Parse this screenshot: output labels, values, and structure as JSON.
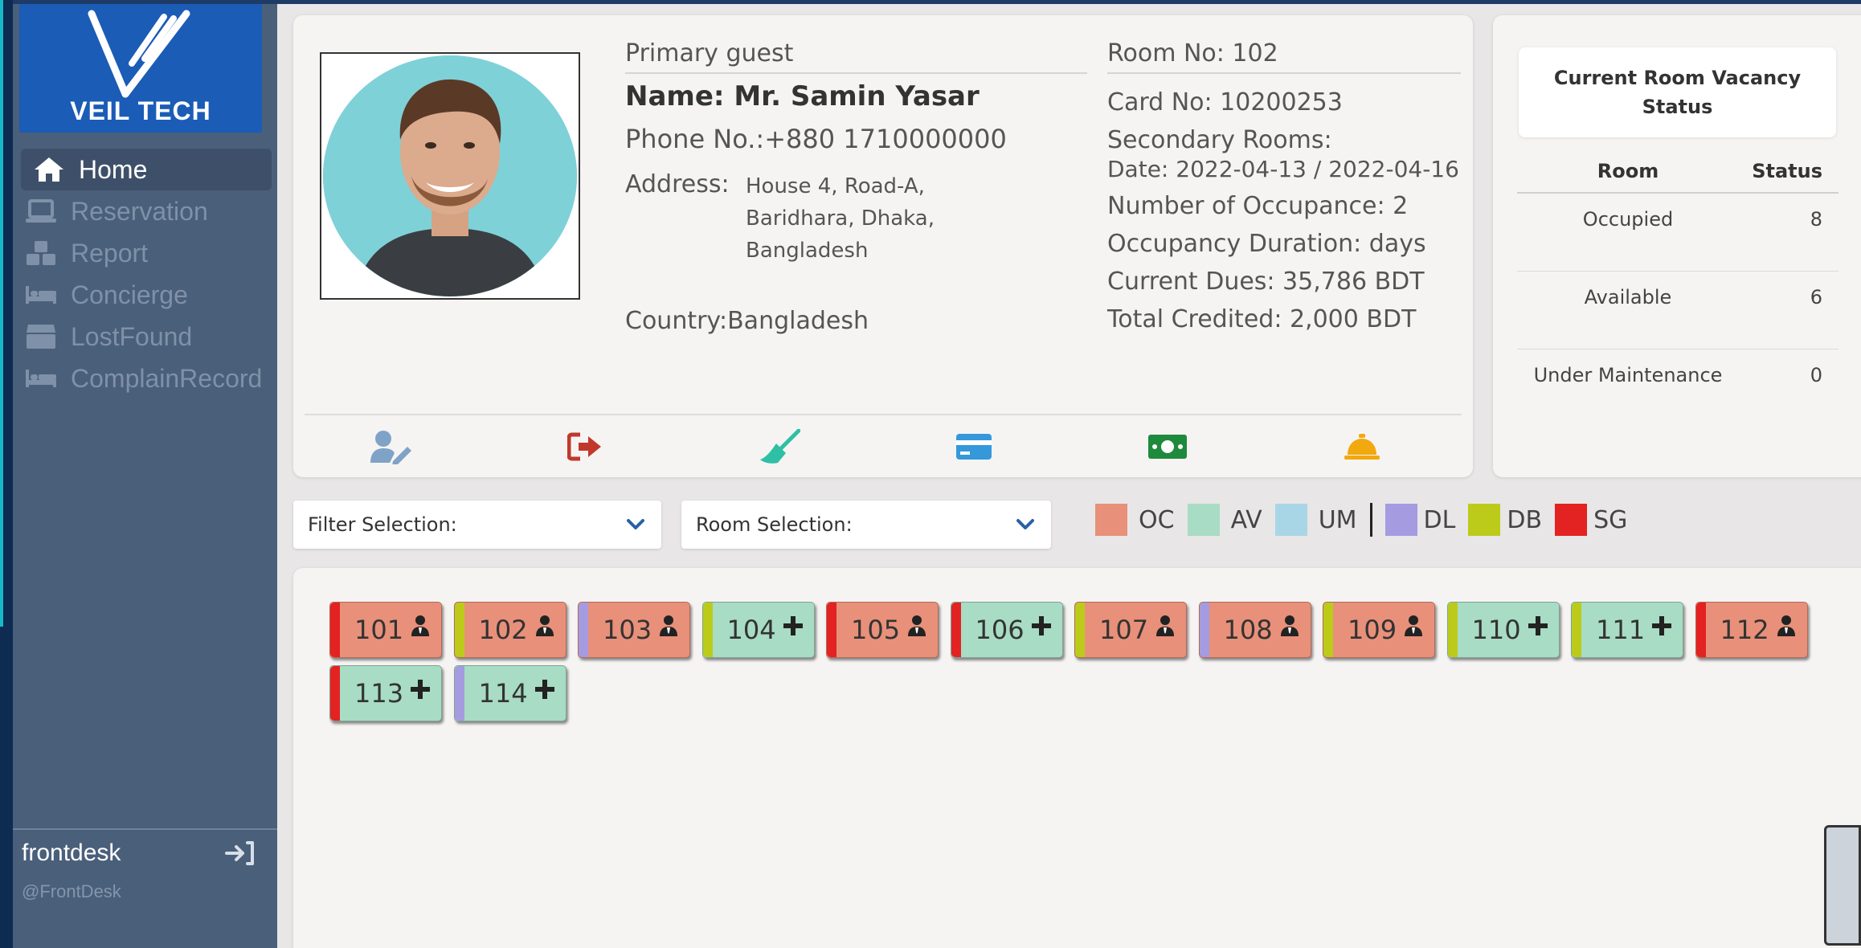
{
  "brand": {
    "name": "VEIL TECH",
    "logo_color": "#1b5cb6"
  },
  "sidebar": {
    "items": [
      {
        "label": "Home",
        "icon": "home-icon",
        "active": true
      },
      {
        "label": "Reservation",
        "icon": "laptop-icon",
        "active": false
      },
      {
        "label": "Report",
        "icon": "cubes-icon",
        "active": false
      },
      {
        "label": "Concierge",
        "icon": "bed-icon",
        "active": false
      },
      {
        "label": "LostFound",
        "icon": "box-icon",
        "active": false
      },
      {
        "label": "ComplainRecord",
        "icon": "bed-icon",
        "active": false
      }
    ],
    "user": {
      "name": "frontdesk",
      "handle": "@FrontDesk"
    }
  },
  "guest": {
    "label": "Primary guest",
    "name": "Name: Mr. Samin Yasar",
    "phone": "Phone No.:+880 1710000000",
    "address_label": "Address:",
    "address_lines": [
      "House 4, Road-A,",
      "Baridhara, Dhaka,",
      "Bangladesh"
    ],
    "country": "Country:Bangladesh"
  },
  "room_info": {
    "room_no": "Room No: 102",
    "card_no": "Card No: 10200253",
    "secondary": "Secondary Rooms:",
    "date": "Date: 2022-04-13 / 2022-04-16",
    "occupants": "Number of Occupance: 2",
    "duration": "Occupancy Duration: days",
    "dues": "Current Dues: 35,786 BDT",
    "credited": "Total Credited: 2,000 BDT"
  },
  "actions": [
    {
      "icon": "user-edit-icon",
      "color": "#7fa3c7"
    },
    {
      "icon": "sign-out-icon",
      "color": "#c0392b"
    },
    {
      "icon": "broom-icon",
      "color": "#2fbfa5"
    },
    {
      "icon": "credit-card-icon",
      "color": "#3498db"
    },
    {
      "icon": "money-bill-icon",
      "color": "#1e8a3c"
    },
    {
      "icon": "concierge-bell-icon",
      "color": "#f2a80f"
    }
  ],
  "vacancy": {
    "title": "Current Room Vacancy Status",
    "headers": [
      "Room",
      "Status"
    ],
    "rows": [
      {
        "room": "Occupied",
        "status": "8"
      },
      {
        "room": "Available",
        "status": "6"
      },
      {
        "room": "Under Maintenance",
        "status": "0"
      }
    ]
  },
  "filters": {
    "filter_selection": "Filter Selection:",
    "room_selection": "Room Selection:"
  },
  "legend": [
    {
      "code": "OC",
      "color": "#e8907a"
    },
    {
      "code": "AV",
      "color": "#a8dcc4"
    },
    {
      "code": "UM",
      "color": "#a9d6e6"
    },
    {
      "code": "DL",
      "color": "#a59be0"
    },
    {
      "code": "DB",
      "color": "#bccb1a"
    },
    {
      "code": "SG",
      "color": "#e32222"
    }
  ],
  "rooms": [
    {
      "number": "101",
      "status": "OC",
      "type": "SG",
      "icon": "occupant-icon"
    },
    {
      "number": "102",
      "status": "OC",
      "type": "DB",
      "icon": "occupant-icon"
    },
    {
      "number": "103",
      "status": "OC",
      "type": "DL",
      "icon": "occupant-icon"
    },
    {
      "number": "104",
      "status": "AV",
      "type": "DB",
      "icon": "plus-icon"
    },
    {
      "number": "105",
      "status": "OC",
      "type": "SG",
      "icon": "occupant-icon"
    },
    {
      "number": "106",
      "status": "AV",
      "type": "SG",
      "icon": "plus-icon"
    },
    {
      "number": "107",
      "status": "OC",
      "type": "DB",
      "icon": "occupant-icon"
    },
    {
      "number": "108",
      "status": "OC",
      "type": "DL",
      "icon": "occupant-icon"
    },
    {
      "number": "109",
      "status": "OC",
      "type": "DB",
      "icon": "occupant-icon"
    },
    {
      "number": "110",
      "status": "AV",
      "type": "DB",
      "icon": "plus-icon"
    },
    {
      "number": "111",
      "status": "AV",
      "type": "DB",
      "icon": "plus-icon"
    },
    {
      "number": "112",
      "status": "OC",
      "type": "SG",
      "icon": "occupant-icon"
    },
    {
      "number": "113",
      "status": "AV",
      "type": "SG",
      "icon": "plus-icon"
    },
    {
      "number": "114",
      "status": "AV",
      "type": "DL",
      "icon": "plus-icon"
    }
  ]
}
